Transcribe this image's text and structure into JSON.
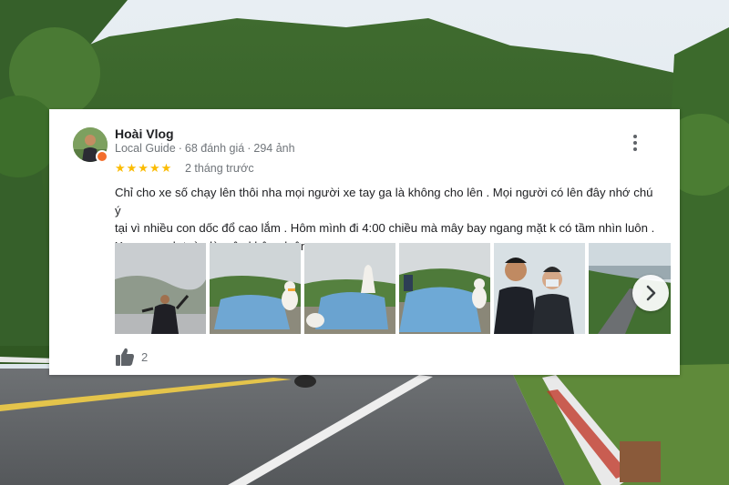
{
  "review": {
    "author_name": "Hoài Vlog",
    "author_level": "Local Guide",
    "review_count": "68 đánh giá",
    "photo_count": "294 ảnh",
    "rating": 5,
    "rating_stars": "★★★★★",
    "time_ago": "2 tháng trước",
    "text_lines": [
      "Chỉ cho xe số chạy lên thôi nha mọi người xe tay ga là không cho lên . Mọi người có lên đây nhớ chú ý",
      "tại vì nhiều con dốc đổ cao lắm .  Hôm mình đi 4:00 chiều mà mây bay ngang mặt k có tầm nhìn luôn .",
      "Xung quanh toàn là mây không luôn"
    ],
    "like_count": "2",
    "photos": [
      {
        "subject": "man-in-fog"
      },
      {
        "subject": "tarp-covered-rock-with-duck"
      },
      {
        "subject": "tarp-covered-rock-with-statue"
      },
      {
        "subject": "tarp-covered-rock-in-fog"
      },
      {
        "subject": "two-people-selfie"
      },
      {
        "subject": "coastal-road-view"
      }
    ]
  },
  "colors": {
    "star": "#fbbc04",
    "secondary_text": "#70757a",
    "primary_text": "#202124",
    "guide_badge": "#f36e2c"
  },
  "icons": {
    "more": "more-vert-icon",
    "like": "thumbs-up-icon",
    "next": "chevron-right-icon"
  }
}
